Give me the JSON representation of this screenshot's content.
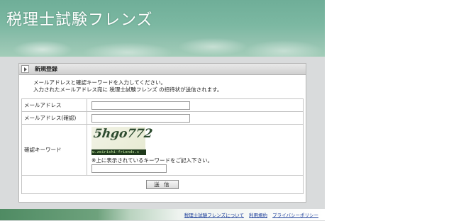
{
  "header": {
    "site_title": "税理士試験フレンズ"
  },
  "panel": {
    "title": "新規登録",
    "intro_line1": "メールアドレスと確認キーワードを入力してください。",
    "intro_line2": "入力されたメールアドレス宛に 税理士試験フレンズ の招待状が送信されます。"
  },
  "form": {
    "email_label": "メールアドレス",
    "email_value": "",
    "email_confirm_label": "メールアドレス(確認)",
    "email_confirm_value": "",
    "captcha_label": "確認キーワード",
    "captcha_word": "5hgo772",
    "captcha_domain": "w.zeirishi-friends.c",
    "captcha_note": "※上に表示されているキーワードをご記入下さい。",
    "captcha_value": "",
    "submit_label": "送 信"
  },
  "footer": {
    "links": [
      "税理士試験フレンズについて",
      "利用規約",
      "プライバシーポリシー"
    ]
  },
  "colors": {
    "header_green": "#7cb8a2",
    "page_bg": "#d9dbdc",
    "link_blue": "#1d3f9a"
  }
}
